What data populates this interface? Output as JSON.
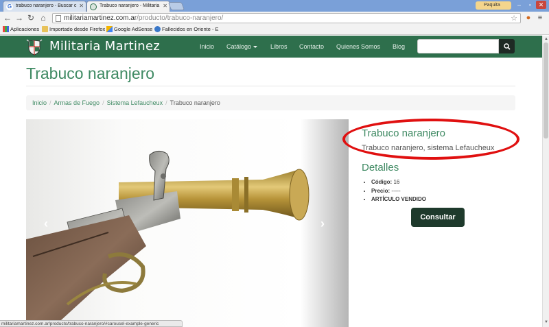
{
  "browser": {
    "tabs": [
      {
        "title": "trabuco naranjero - Buscar c",
        "icon": "google-icon"
      },
      {
        "title": "Trabuco naranjero - Militaria",
        "icon": "site-icon"
      }
    ],
    "user_label": "Paquita",
    "url_host": "militariamartinez.com.ar",
    "url_path": "/producto/trabuco-naranjero/",
    "bookmarks": [
      {
        "label": "Aplicaciones",
        "icon": "apps-grid-icon"
      },
      {
        "label": "Importado desde Firefox",
        "icon": "folder-icon"
      },
      {
        "label": "Google AdSense",
        "icon": "adsense-icon"
      },
      {
        "label": "Fallecidos en Oriente - E",
        "icon": "info-icon"
      }
    ],
    "status_text": "militariamartinez.com.ar/producto/trabuco-naranjero/#carousel-example-generic"
  },
  "site": {
    "brand": "Militaria Martinez",
    "nav": {
      "inicio": "Inicio",
      "catalogo": "Catálogo",
      "libros": "Libros",
      "contacto": "Contacto",
      "quienes": "Quienes Somos",
      "blog": "Blog"
    },
    "search_placeholder": ""
  },
  "page": {
    "title": "Trabuco naranjero",
    "breadcrumb": {
      "inicio": "Inicio",
      "armas": "Armas de Fuego",
      "sistema": "Sistema Lefaucheux",
      "current": "Trabuco naranjero"
    },
    "product": {
      "title": "Trabuco naranjero",
      "description": "Trabuco naranjero, sistema Lefaucheux",
      "details_heading": "Detalles",
      "code_label": "Código:",
      "code_value": "16",
      "price_label": "Precio:",
      "price_value": "-----",
      "sold_label": "ARTÍCULO VENDIDO",
      "consult_button": "Consultar"
    }
  },
  "colors": {
    "brand_green": "#2e6f4c",
    "title_green": "#3f8a63",
    "highlight_red": "#e01010",
    "button_dark": "#1e3a2c"
  }
}
